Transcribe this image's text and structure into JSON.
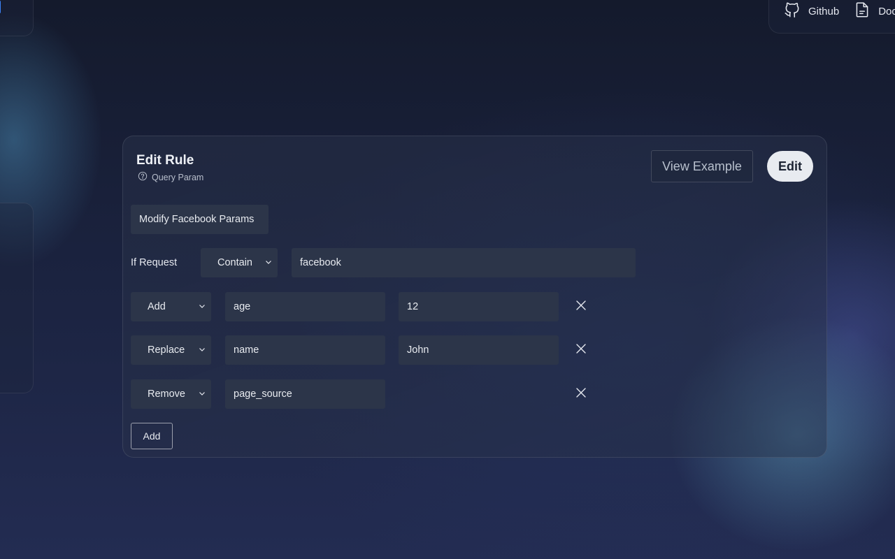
{
  "topnav": {
    "github_label": "Github",
    "docs_label": "Doc"
  },
  "rule": {
    "title": "Edit Rule",
    "subtitle": "Query Param",
    "view_example_label": "View Example",
    "edit_label": "Edit",
    "name_value": "Modify Facebook Params",
    "condition_label": "If Request",
    "condition_operator": "Contain",
    "condition_value": "facebook",
    "params": [
      {
        "action": "Add",
        "key": "age",
        "value": "12"
      },
      {
        "action": "Replace",
        "key": "name",
        "value": "John"
      },
      {
        "action": "Remove",
        "key": "page_source",
        "value": ""
      }
    ],
    "add_label": "Add"
  },
  "icons": {
    "github": "github-icon",
    "docs": "document-icon",
    "help": "question-circle-icon",
    "chevron": "chevron-down-icon",
    "remove": "close-icon"
  }
}
